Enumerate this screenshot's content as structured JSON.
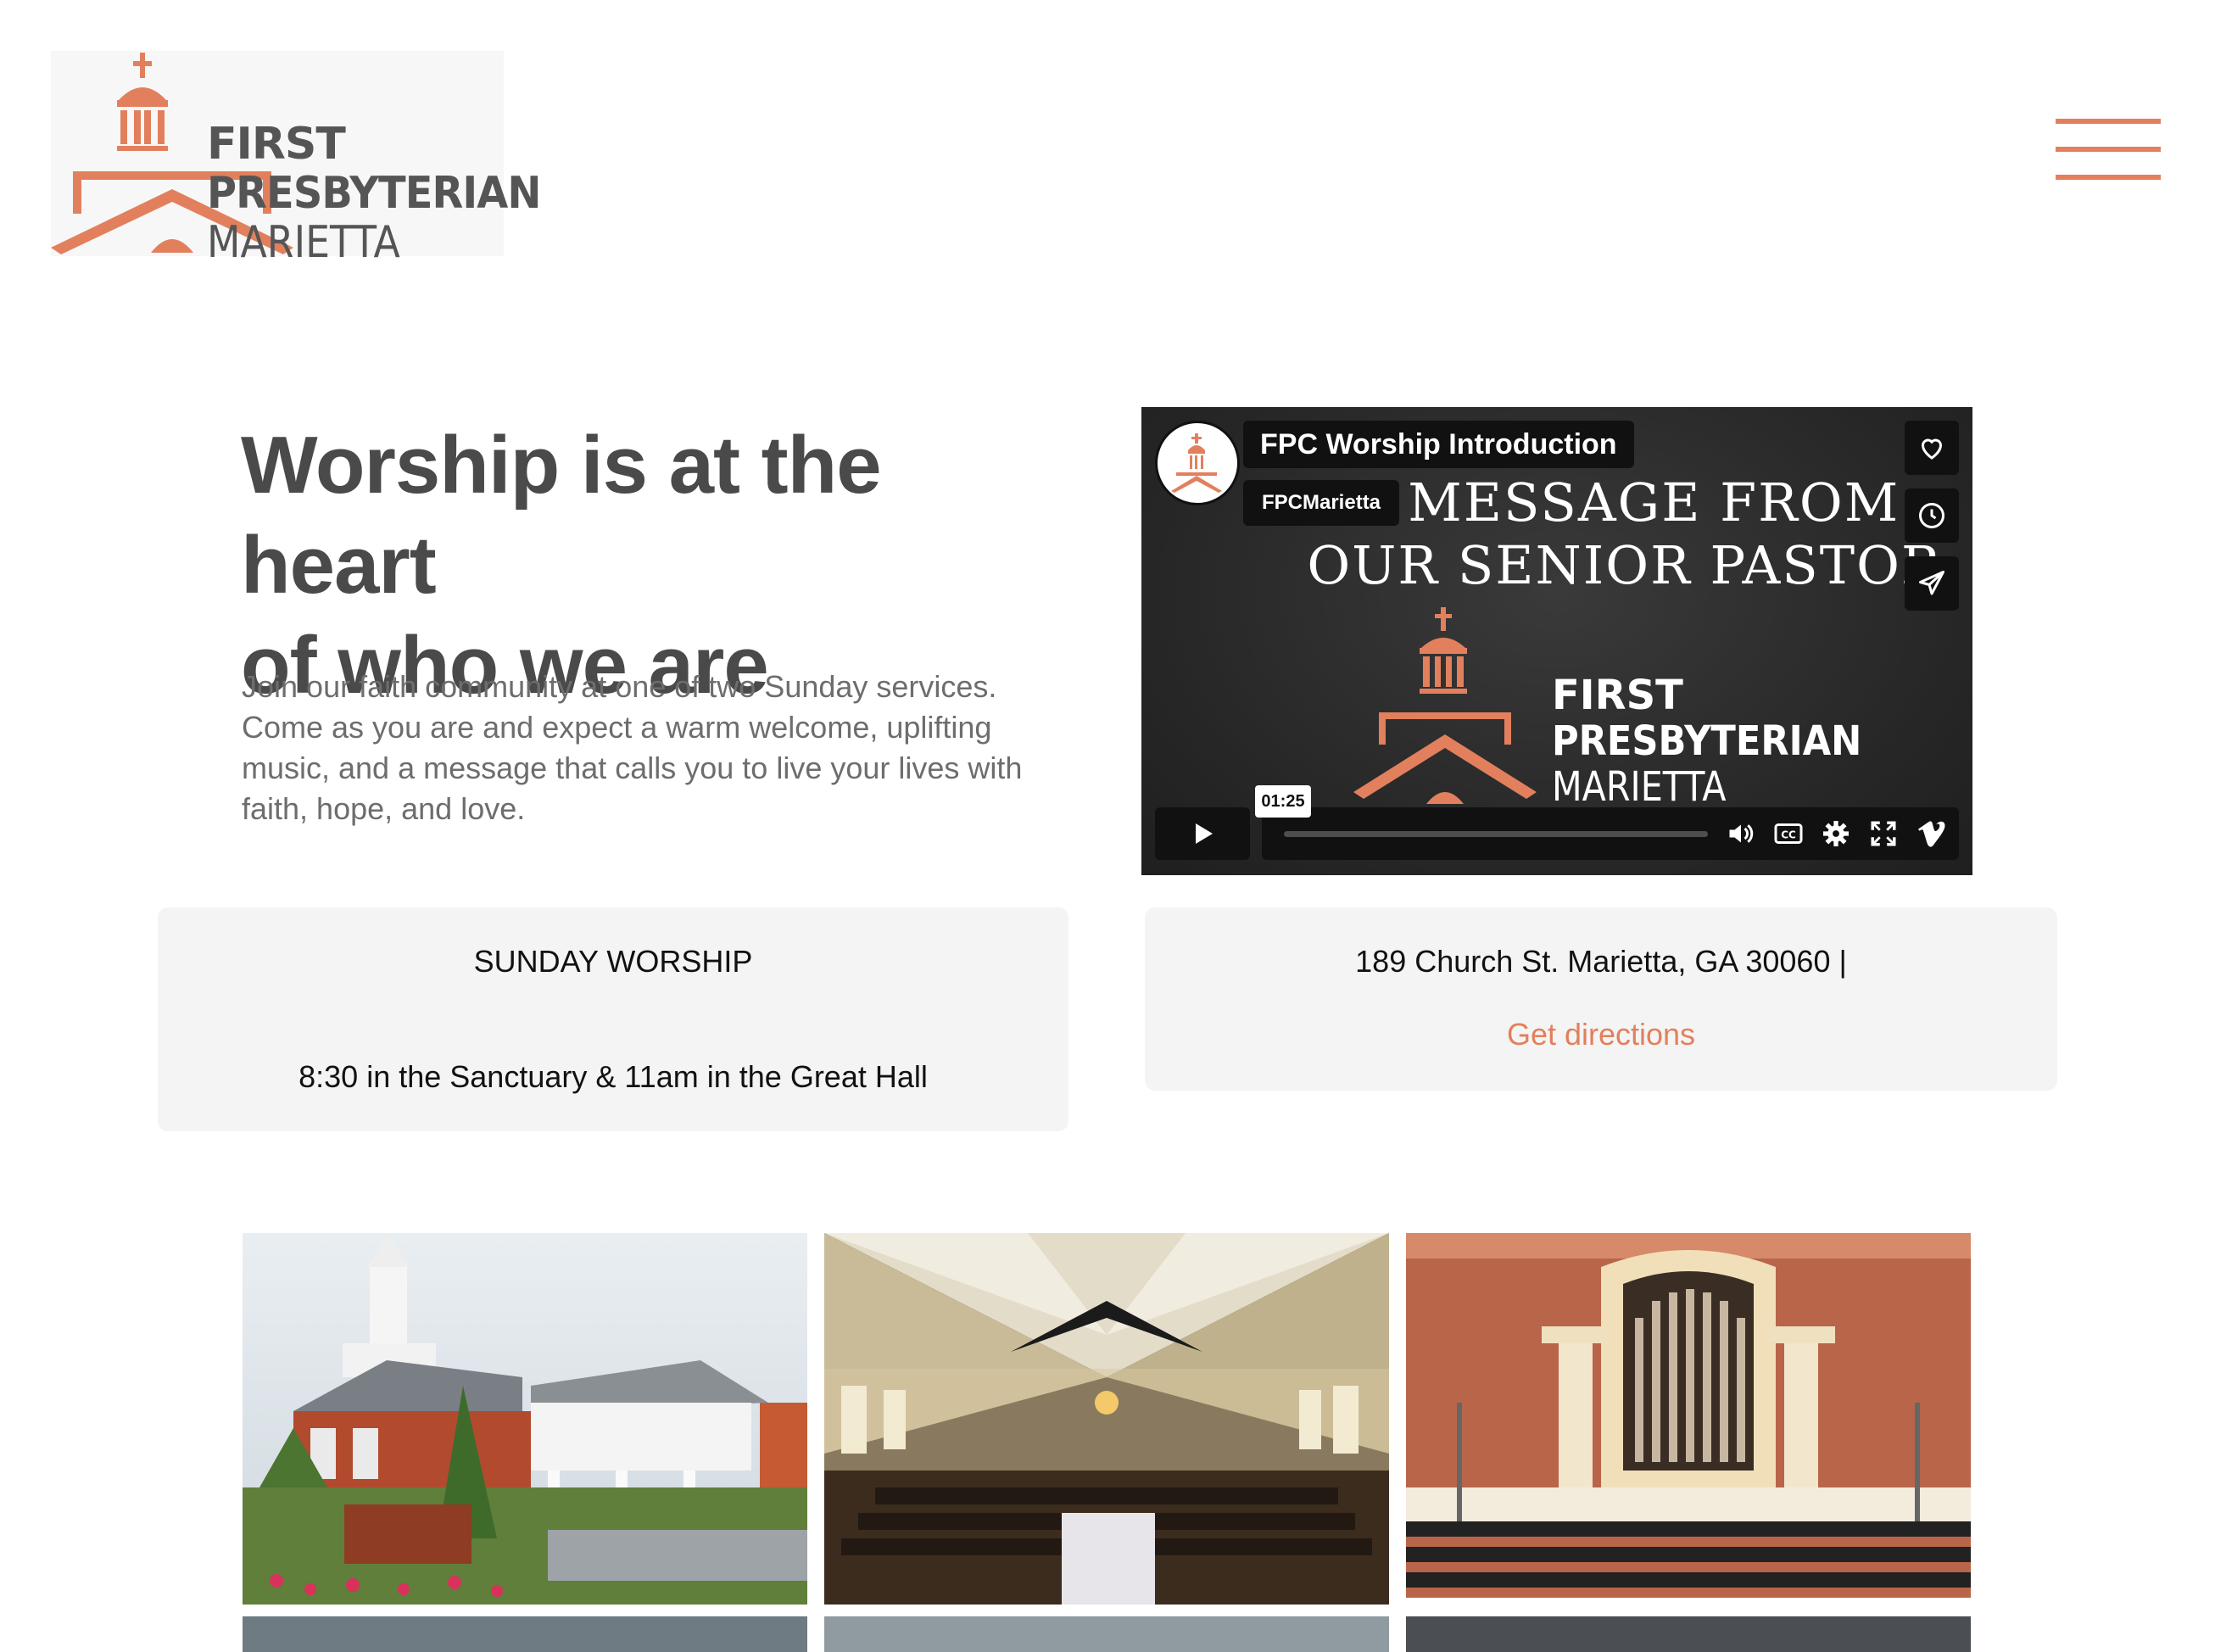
{
  "header": {
    "logo": {
      "line1": "FIRST",
      "line2": "PRESBYTERIAN",
      "line3": "MARIETTA"
    },
    "menu_icon": "hamburger-icon"
  },
  "hero": {
    "headline_line1": "Worship is at the heart",
    "headline_line2": "of who we are",
    "intro_line1": "Join our faith community at one of two Sunday services.",
    "intro_line2": "Come as you are and expect a warm welcome, uplifting",
    "intro_line3": "music, and a message that calls you to live your lives with",
    "intro_line4": "faith, hope, and love."
  },
  "video": {
    "title": "FPC Worship Introduction",
    "channel": "FPCMarietta",
    "slide_line1": "A MESSAGE FROM",
    "slide_line2": "OUR SENIOR PASTOR",
    "logo_line1": "FIRST",
    "logo_line2": "PRESBYTERIAN",
    "logo_line3": "MARIETTA",
    "time_tooltip": "01:25",
    "side_buttons": [
      "heart-icon",
      "clock-icon",
      "send-icon"
    ],
    "controls": [
      "volume-icon",
      "cc-icon",
      "settings-icon",
      "fullscreen-icon",
      "vimeo-icon"
    ]
  },
  "worship_card": {
    "heading": "SUNDAY WORSHIP",
    "detail": "8:30 in the Sanctuary & 11am in the Great Hall"
  },
  "address_card": {
    "address": "189 Church St. Marietta, GA 30060 |",
    "link": "Get directions"
  },
  "gallery": {
    "photos": [
      "church-exterior",
      "great-hall-interior",
      "sanctuary-organ"
    ]
  },
  "colors": {
    "accent": "#e2805d",
    "card_bg": "#f4f4f4",
    "video_bg": "#2a2a2a"
  }
}
